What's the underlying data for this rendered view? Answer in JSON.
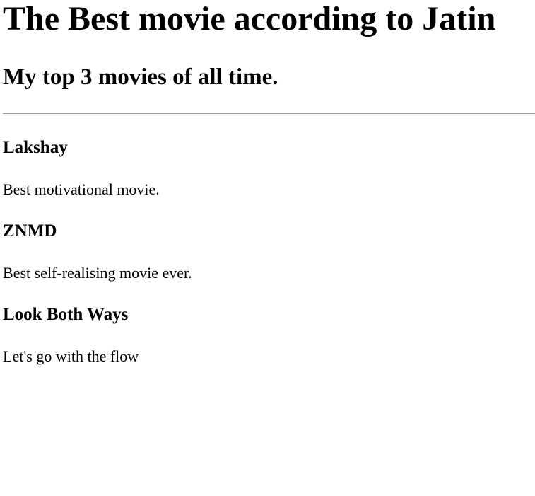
{
  "page": {
    "title": "The Best movie according to Jatin",
    "subtitle": "My top 3 movies of all time."
  },
  "movies": [
    {
      "name": "Lakshay",
      "description": "Best motivational movie."
    },
    {
      "name": "ZNMD",
      "description": "Best self-realising movie ever."
    },
    {
      "name": "Look Both Ways",
      "description": "Let's go with the flow"
    }
  ]
}
